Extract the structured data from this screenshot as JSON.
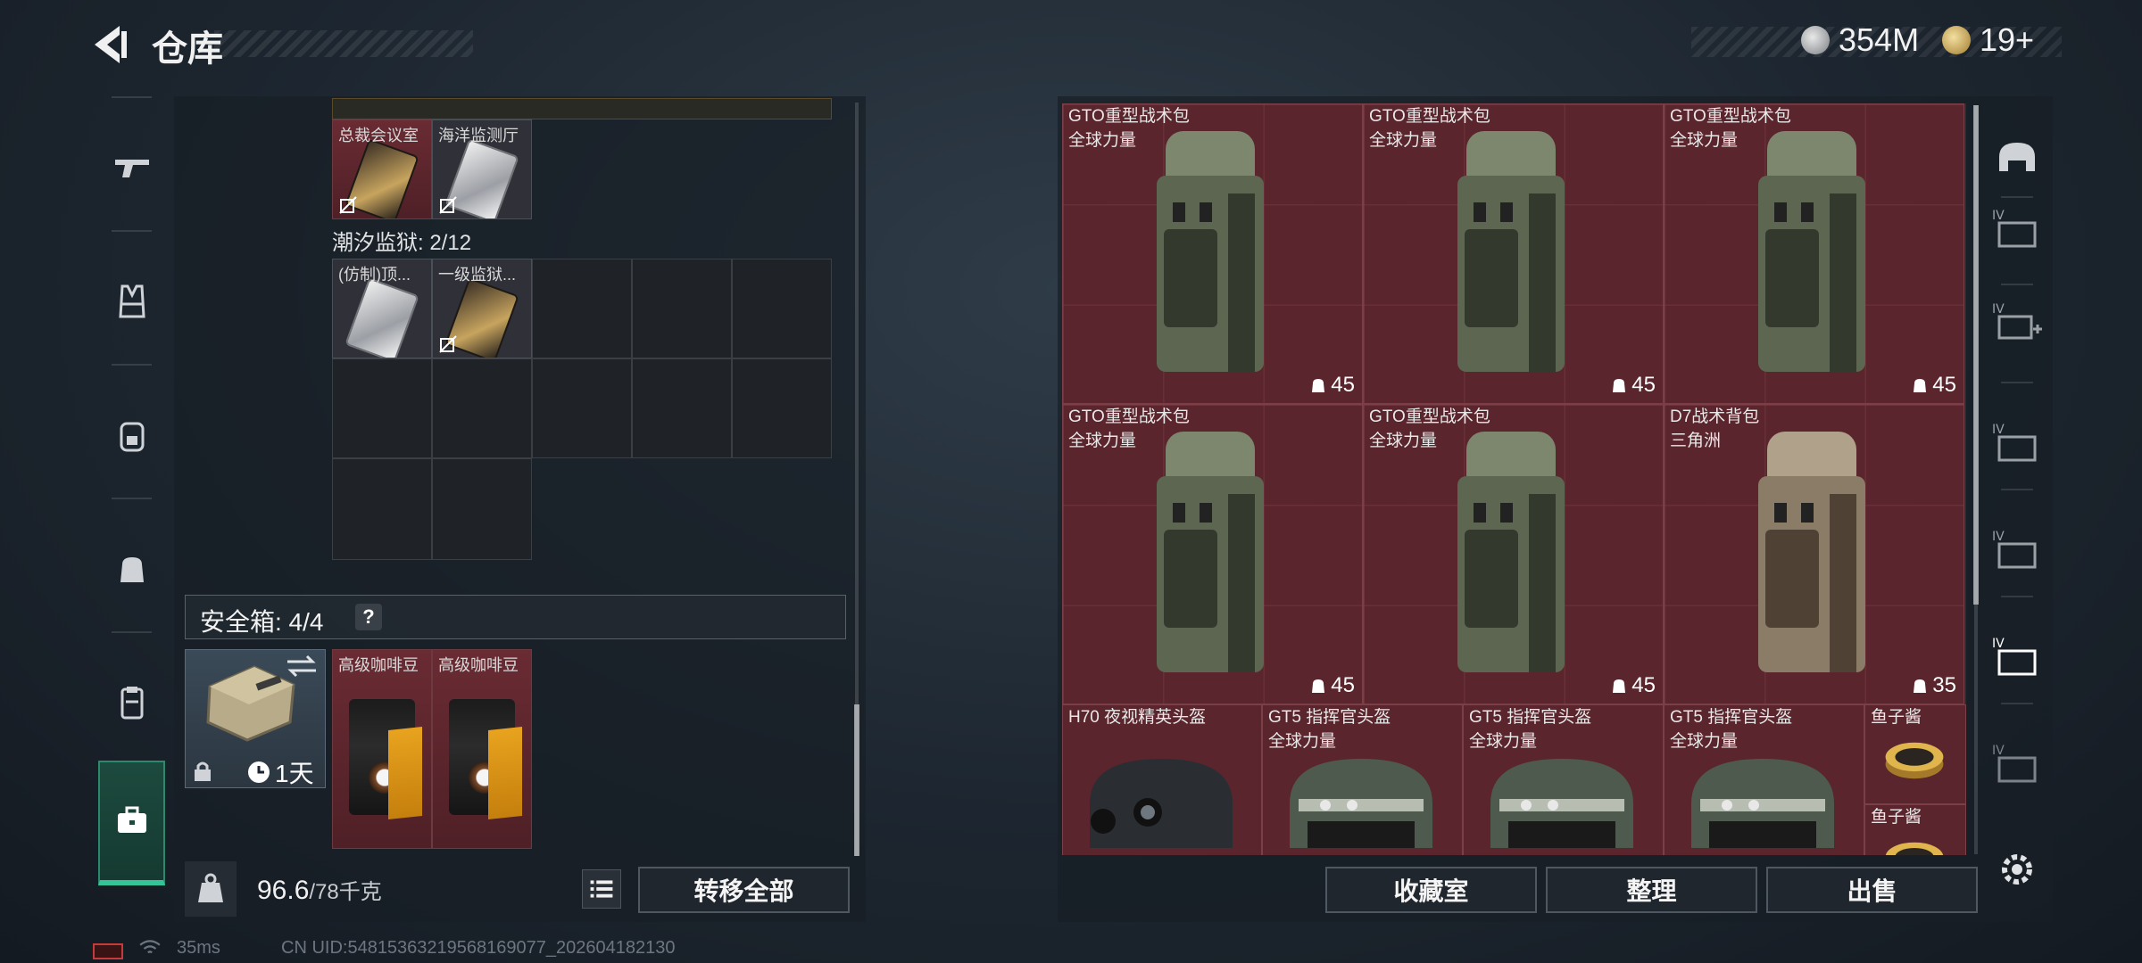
{
  "header": {
    "title": "仓库",
    "currency_silver": "354M",
    "currency_gold": "19+"
  },
  "stash": {
    "top_cells": [
      {
        "label": "总裁会议室",
        "card": "gold"
      },
      {
        "label": "海洋监测厅",
        "card": "silver"
      }
    ],
    "section_label": "潮汐监狱: 2/12",
    "section_cells": [
      {
        "label": "(仿制)顶...",
        "card": "silver"
      },
      {
        "label": "一级监狱...",
        "card": "gold"
      }
    ],
    "safe_label": "安全箱: 4/4",
    "safe_help": "?",
    "safe_duration": "1天",
    "coffee_items": [
      {
        "label": "高级咖啡豆"
      },
      {
        "label": "高级咖啡豆"
      }
    ]
  },
  "footer_left": {
    "weight_value": "96.6",
    "weight_max": "/78千克",
    "transfer_all_label": "转移全部"
  },
  "status": {
    "ping": "35ms",
    "uid": "CN UID:5481536321956816​9077_202604182130"
  },
  "inventory": {
    "backpacks": [
      {
        "name": "GTO重型战术包",
        "sub": "全球力量",
        "qty": "45",
        "tone": "green"
      },
      {
        "name": "GTO重型战术包",
        "sub": "全球力量",
        "qty": "45",
        "tone": "green"
      },
      {
        "name": "GTO重型战术包",
        "sub": "全球力量",
        "qty": "45",
        "tone": "green"
      },
      {
        "name": "GTO重型战术包",
        "sub": "全球力量",
        "qty": "45",
        "tone": "green"
      },
      {
        "name": "GTO重型战术包",
        "sub": "全球力量",
        "qty": "45",
        "tone": "green"
      },
      {
        "name": "D7战术背包",
        "sub": "三角洲",
        "qty": "35",
        "tone": "tan"
      }
    ],
    "helmets": [
      {
        "name": "H70 夜视精英头盔",
        "sub": ""
      },
      {
        "name": "GT5 指挥官头盔",
        "sub": "全球力量"
      },
      {
        "name": "GT5 指挥官头盔",
        "sub": "全球力量"
      },
      {
        "name": "GT5 指挥官头盔",
        "sub": "全球力量"
      }
    ],
    "small_items": [
      {
        "name": "鱼子酱"
      },
      {
        "name": "鱼子酱"
      }
    ]
  },
  "footer_right": {
    "collection_label": "收藏室",
    "sort_label": "整理",
    "sell_label": "出售"
  },
  "colors": {
    "accent_green": "#34c497",
    "item_red": "#5a252c",
    "panel": "#171e25"
  }
}
